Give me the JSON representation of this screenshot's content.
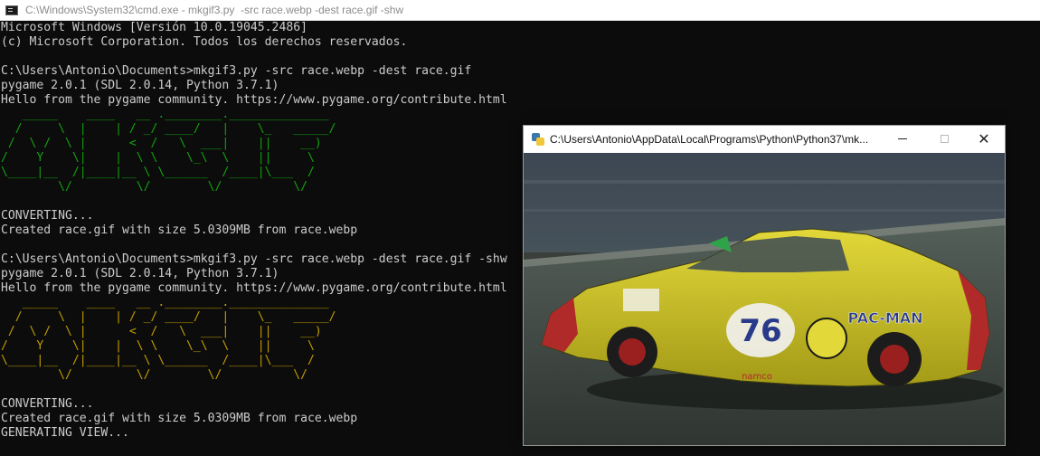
{
  "cmd": {
    "title": "C:\\Windows\\System32\\cmd.exe - mkgif3.py  -src race.webp -dest race.gif -shw",
    "lines": [
      {
        "text": "Microsoft Windows [Versión 10.0.19045.2486]",
        "color": "default"
      },
      {
        "text": "(c) Microsoft Corporation. Todos los derechos reservados.",
        "color": "default"
      },
      {
        "text": "",
        "color": "default"
      },
      {
        "text": "C:\\Users\\Antonio\\Documents>mkgif3.py -src race.webp -dest race.gif",
        "color": "default"
      },
      {
        "text": "pygame 2.0.1 (SDL 2.0.14, Python 3.7.1)",
        "color": "default"
      },
      {
        "text": "Hello from the pygame community. https://www.pygame.org/contribute.html",
        "color": "default"
      },
      {
        "text": "   _____    ____   __ .________.______________",
        "color": "green"
      },
      {
        "text": "  /     \\  |    | / _/ ____/   |    \\_   _____/",
        "color": "green"
      },
      {
        "text": " /  \\ /  \\ |      <  /   \\  ___|    ||    __)",
        "color": "green"
      },
      {
        "text": "/    Y    \\|    |  \\ \\    \\_\\  \\    ||     \\",
        "color": "green"
      },
      {
        "text": "\\____|__  /|____|__ \\ \\______  /____|\\___  /",
        "color": "green"
      },
      {
        "text": "        \\/         \\/        \\/          \\/",
        "color": "green"
      },
      {
        "text": "",
        "color": "default"
      },
      {
        "text": "CONVERTING...",
        "color": "default"
      },
      {
        "text": "Created race.gif with size 5.0309MB from race.webp",
        "color": "default"
      },
      {
        "text": "",
        "color": "default"
      },
      {
        "text": "C:\\Users\\Antonio\\Documents>mkgif3.py -src race.webp -dest race.gif -shw",
        "color": "default"
      },
      {
        "text": "pygame 2.0.1 (SDL 2.0.14, Python 3.7.1)",
        "color": "default"
      },
      {
        "text": "Hello from the pygame community. https://www.pygame.org/contribute.html",
        "color": "default"
      },
      {
        "text": "   _____    ____   __ .________.______________",
        "color": "yellow"
      },
      {
        "text": "  /     \\  |    | / _/ ____/   |    \\_   _____/",
        "color": "yellow"
      },
      {
        "text": " /  \\ /  \\ |      <  /   \\  ___|    ||    __)",
        "color": "yellow"
      },
      {
        "text": "/    Y    \\|    |  \\ \\    \\_\\  \\    ||     \\",
        "color": "yellow"
      },
      {
        "text": "\\____|__  /|____|__ \\ \\______  /____|\\___  /",
        "color": "yellow"
      },
      {
        "text": "        \\/         \\/        \\/          \\/",
        "color": "yellow"
      },
      {
        "text": "",
        "color": "default"
      },
      {
        "text": "CONVERTING...",
        "color": "default"
      },
      {
        "text": "Created race.gif with size 5.0309MB from race.webp",
        "color": "default"
      },
      {
        "text": "GENERATING VIEW...",
        "color": "default"
      }
    ]
  },
  "pygame_window": {
    "title": "C:\\Users\\Antonio\\AppData\\Local\\Programs\\Python\\Python37\\mk...",
    "car_number": "76",
    "car_sponsor": "PAC-MAN",
    "car_brand": "namco",
    "icons": [
      "python-icon",
      "minimize-icon",
      "maximize-icon",
      "close-icon"
    ]
  },
  "colors": {
    "console_bg": "#0c0c0c",
    "console_text": "#cccccc",
    "banner_green": "#13a10e",
    "banner_yellow": "#c19c00",
    "car_yellow": "#d8c82a"
  }
}
